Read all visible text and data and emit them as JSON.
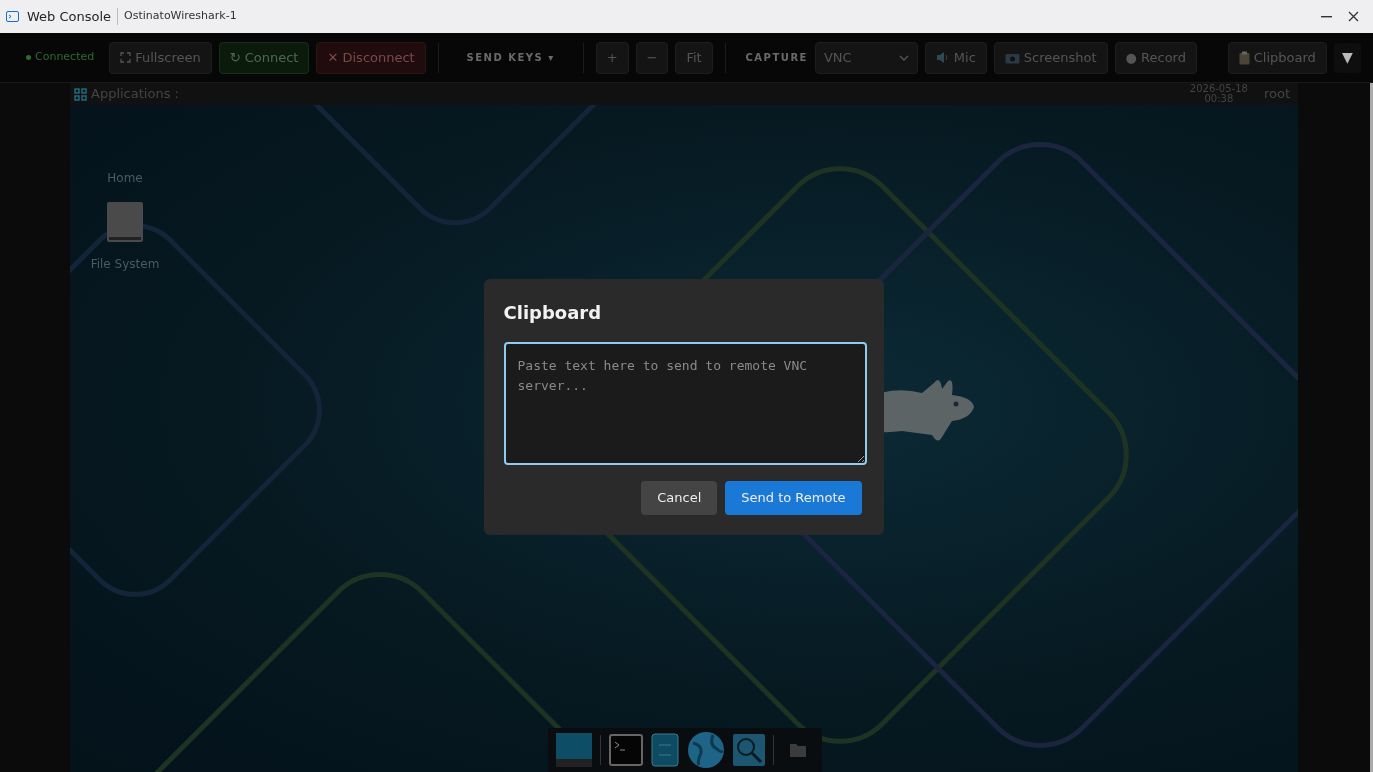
{
  "window": {
    "title": "Web Console",
    "subtitle": "OstinatoWireshark-1"
  },
  "toolbar": {
    "items": [
      {
        "kind": "status",
        "label": "Connected",
        "connected": true
      },
      {
        "kind": "fullscreen",
        "label": "Fullscreen"
      },
      {
        "kind": "success",
        "label": "↻ Connect"
      },
      {
        "kind": "danger",
        "label": "✕ Disconnect"
      },
      {
        "kind": "separator"
      },
      {
        "kind": "menu",
        "label": "SEND KEYS",
        "caret": "▾"
      },
      {
        "kind": "separator"
      },
      {
        "kind": "button",
        "label": "+"
      },
      {
        "kind": "button",
        "label": "−"
      },
      {
        "kind": "button",
        "label": "Fit"
      },
      {
        "kind": "separator"
      },
      {
        "kind": "label",
        "label": "CAPTURE"
      },
      {
        "kind": "select",
        "value": "VNC"
      },
      {
        "kind": "mic",
        "label": "Mic"
      },
      {
        "kind": "screenshot",
        "label": "Screenshot"
      },
      {
        "kind": "button",
        "label": "● Record"
      },
      {
        "kind": "spacer"
      },
      {
        "kind": "clipboard",
        "label": "Clipboard"
      },
      {
        "kind": "dropdown",
        "label": "▼"
      }
    ]
  },
  "desktop": {
    "panel": {
      "menu": "Applications :",
      "date": "2026-05-18",
      "time": "00:38",
      "user": "root"
    },
    "icons": [
      {
        "label": "Home",
        "kind": "plain"
      },
      {
        "label": "File System",
        "kind": "drive"
      }
    ]
  },
  "dialog": {
    "title": "Clipboard",
    "placeholder": "Paste text here to send to remote VNC server...",
    "buttons": [
      {
        "label": "Cancel",
        "kind": "secondary"
      },
      {
        "label": "Send to Remote",
        "kind": "primary"
      }
    ]
  }
}
